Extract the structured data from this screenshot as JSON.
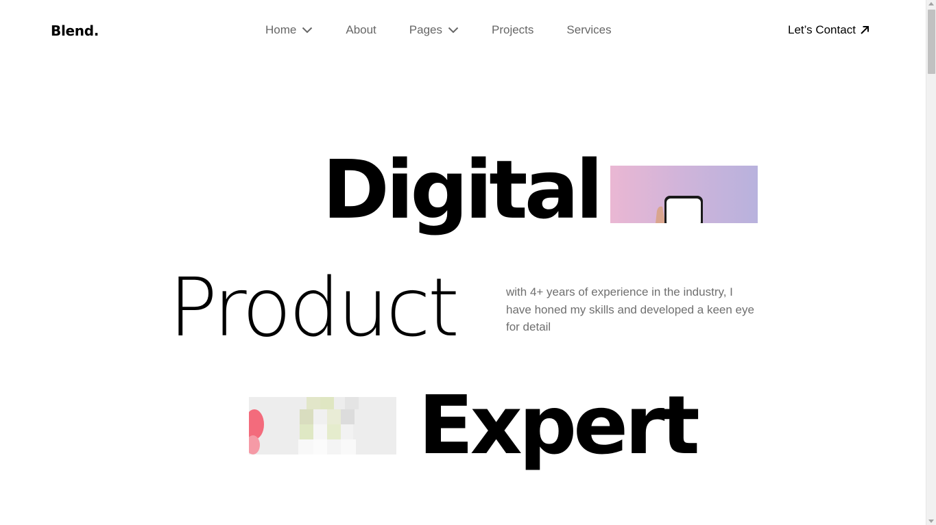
{
  "header": {
    "logo": "Blend.",
    "nav": [
      {
        "label": "Home",
        "has_dropdown": true
      },
      {
        "label": "About",
        "has_dropdown": false
      },
      {
        "label": "Pages",
        "has_dropdown": true
      },
      {
        "label": "Projects",
        "has_dropdown": false
      },
      {
        "label": "Services",
        "has_dropdown": false
      }
    ],
    "contact_label": "Let’s Contact",
    "contact_icon": "arrow-up-right-icon",
    "dropdown_icon": "chevron-down-icon"
  },
  "hero": {
    "word_1": "Digital",
    "word_2": "Product",
    "word_3": "Expert",
    "description": "with 4+ years of experience in the industry, I have honed my skills and developed a keen eye for detail",
    "image_1": "phone-in-hand-image",
    "image_2": "stacked-cubes-image"
  },
  "colors": {
    "text": "#000000",
    "nav_text": "#666666",
    "description_text": "#6f6f6f",
    "background": "#ffffff",
    "image_1_gradient": [
      "#e9b8d4",
      "#b9b1dc"
    ],
    "image_2_accent": "#f25a6e"
  }
}
